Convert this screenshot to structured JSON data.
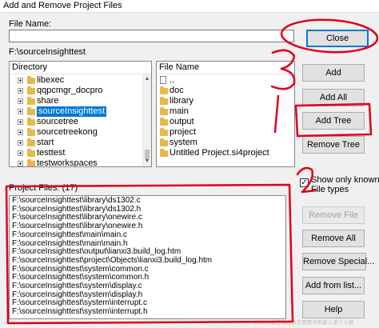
{
  "window": {
    "title": "Add and Remove Project Files"
  },
  "file_name": {
    "label": "File Name:",
    "value": ""
  },
  "current_path": "F:\\sourceInsighttest",
  "directory": {
    "header": "Directory",
    "items": [
      {
        "label": "libexec",
        "selected": false
      },
      {
        "label": "qqpcmgr_docpro",
        "selected": false
      },
      {
        "label": "share",
        "selected": false
      },
      {
        "label": "sourceInsighttest",
        "selected": true
      },
      {
        "label": "sourcetree",
        "selected": false
      },
      {
        "label": "sourcetreekong",
        "selected": false
      },
      {
        "label": "start",
        "selected": false
      },
      {
        "label": "testtest",
        "selected": false
      },
      {
        "label": "testworkspaces",
        "selected": false
      }
    ]
  },
  "file_list": {
    "header": "File Name",
    "items": [
      {
        "label": "..",
        "icon": "folder-icon"
      },
      {
        "label": "doc",
        "icon": "folder-icon"
      },
      {
        "label": "library",
        "icon": "folder-icon"
      },
      {
        "label": "main",
        "icon": "folder-icon"
      },
      {
        "label": "output",
        "icon": "folder-icon"
      },
      {
        "label": "project",
        "icon": "folder-icon"
      },
      {
        "label": "system",
        "icon": "folder-icon"
      },
      {
        "label": "Untitled Project.si4project",
        "icon": "folder-icon"
      }
    ]
  },
  "project_files": {
    "header": "Project Files: (17)",
    "items": [
      "F:\\sourceInsighttest\\library\\ds1302.c",
      "F:\\sourceInsighttest\\library\\ds1302.h",
      "F:\\sourceInsighttest\\library\\onewire.c",
      "F:\\sourceInsighttest\\library\\onewire.h",
      "F:\\sourceInsighttest\\main\\main.c",
      "F:\\sourceInsighttest\\main\\main.h",
      "F:\\sourceInsighttest\\output\\lianxi3.build_log.htm",
      "F:\\sourceInsighttest\\project\\Objects\\lianxi3.build_log.htm",
      "F:\\sourceInsighttest\\system\\common.c",
      "F:\\sourceInsighttest\\system\\common.h",
      "F:\\sourceInsighttest\\system\\display.c",
      "F:\\sourceInsighttest\\system\\display.h",
      "F:\\sourceInsighttest\\system\\interrupt.c",
      "F:\\sourceInsighttest\\system\\interrupt.h"
    ]
  },
  "buttons": {
    "close": "Close",
    "add": "Add",
    "add_all": "Add All",
    "add_tree": "Add Tree",
    "remove_tree": "Remove Tree",
    "remove_file": "Remove File",
    "remove_all": "Remove All",
    "remove_special": "Remove Special...",
    "add_from_list": "Add from list...",
    "help": "Help"
  },
  "show_only_known": {
    "label_line1": "Show only known",
    "label_line2": "File types",
    "checked": true
  },
  "annotations": {
    "mark_1": "1",
    "mark_2": "2",
    "mark_3": "3",
    "color": "#e0001a"
  },
  "watermark": "CSDN @还有好多东西要学的新人求个小赞"
}
